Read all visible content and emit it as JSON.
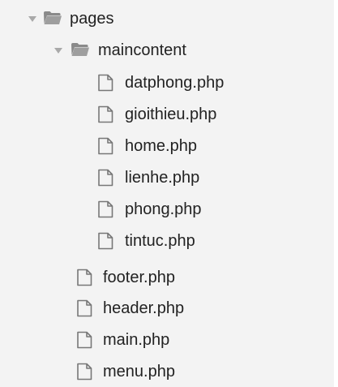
{
  "tree": {
    "pages": {
      "label": "pages",
      "maincontent": {
        "label": "maincontent",
        "files": [
          "datphong.php",
          "gioithieu.php",
          "home.php",
          "lienhe.php",
          "phong.php",
          "tintuc.php"
        ]
      },
      "files": [
        "footer.php",
        "header.php",
        "main.php",
        "menu.php"
      ]
    }
  },
  "icons": {
    "arrow": "disclosure-triangle-down",
    "folder": "folder-open",
    "file": "file"
  },
  "colors": {
    "panel_background": "#f3f3f3",
    "text": "#222222",
    "icon_stroke": "#777777"
  }
}
